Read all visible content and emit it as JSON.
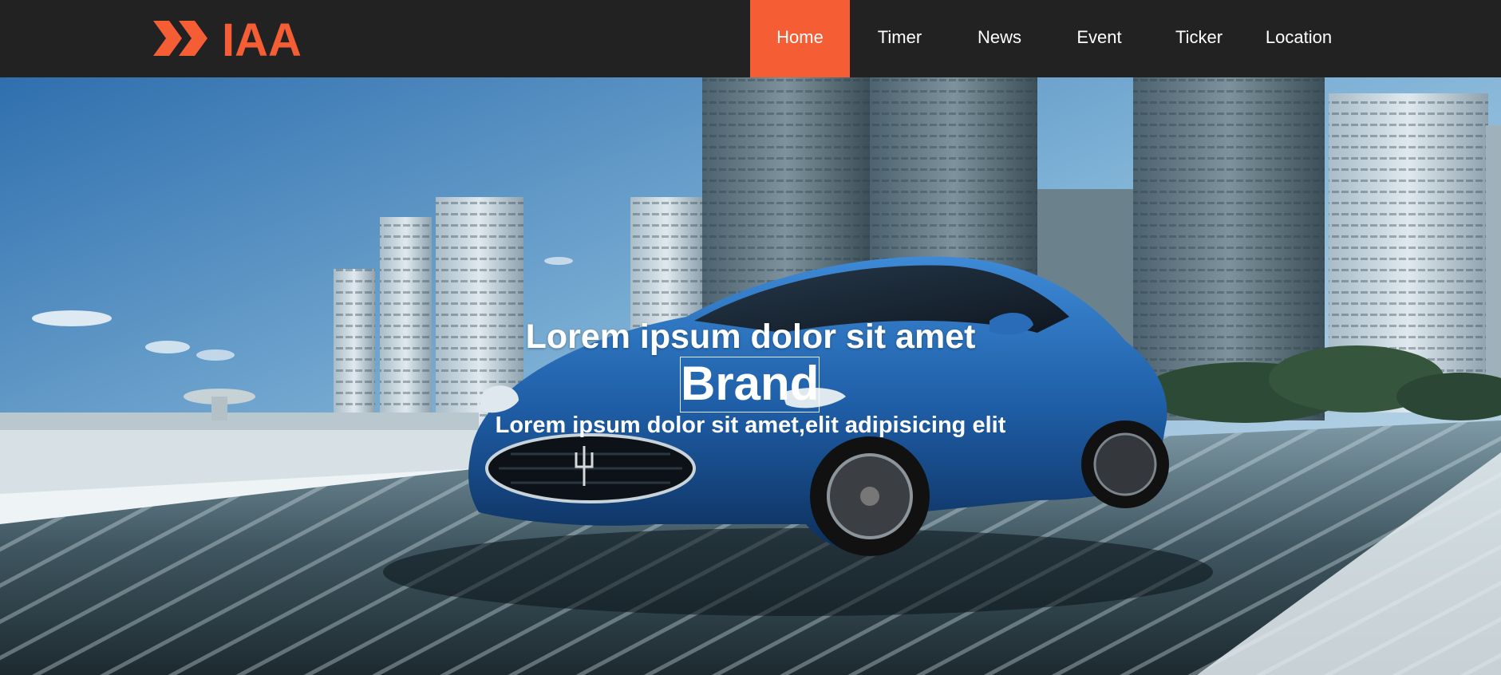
{
  "logo": {
    "text": "IAA",
    "color": "#f55d34"
  },
  "nav": {
    "items": [
      {
        "label": "Home",
        "active": true
      },
      {
        "label": "Timer",
        "active": false
      },
      {
        "label": "News",
        "active": false
      },
      {
        "label": "Event",
        "active": false
      },
      {
        "label": "Ticker",
        "active": false
      },
      {
        "label": "Location",
        "active": false
      }
    ]
  },
  "hero": {
    "headline": "Lorem ipsum dolor sit amet",
    "brand": "Brand",
    "subline": "Lorem ipsum dolor sit amet,elit adipisicing elit"
  },
  "colors": {
    "accent": "#f55d34",
    "navbar": "#222222",
    "car": "#1f5fa8"
  }
}
